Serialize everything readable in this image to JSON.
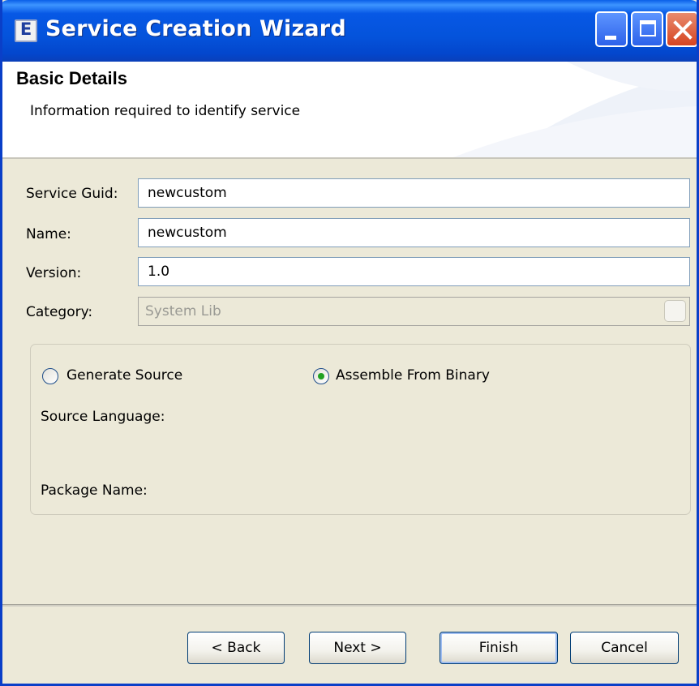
{
  "window": {
    "title": "Service Creation Wizard",
    "icon": "eclipse-app-icon",
    "icon_glyph": "E"
  },
  "header": {
    "title": "Basic Details",
    "description": "Information required to identify service"
  },
  "form": {
    "service_guid": {
      "label": "Service Guid:",
      "value": "newcustom"
    },
    "name": {
      "label": "Name:",
      "value": "newcustom"
    },
    "version": {
      "label": "Version:",
      "value": "1.0"
    },
    "category": {
      "label": "Category:",
      "value": "System Lib",
      "enabled": false
    }
  },
  "source_group": {
    "options": [
      {
        "label": "Generate Source",
        "selected": false
      },
      {
        "label": "Assemble From Binary",
        "selected": true
      }
    ],
    "source_language_label": "Source Language:",
    "package_name_label": "Package Name:"
  },
  "buttons": {
    "back": "< Back",
    "next": "Next >",
    "finish": "Finish",
    "cancel": "Cancel"
  },
  "colors": {
    "titlebar": "#0453db",
    "dialog_bg": "#ece9d8",
    "radio_selected": "#21a121",
    "close_button": "#d64420"
  }
}
